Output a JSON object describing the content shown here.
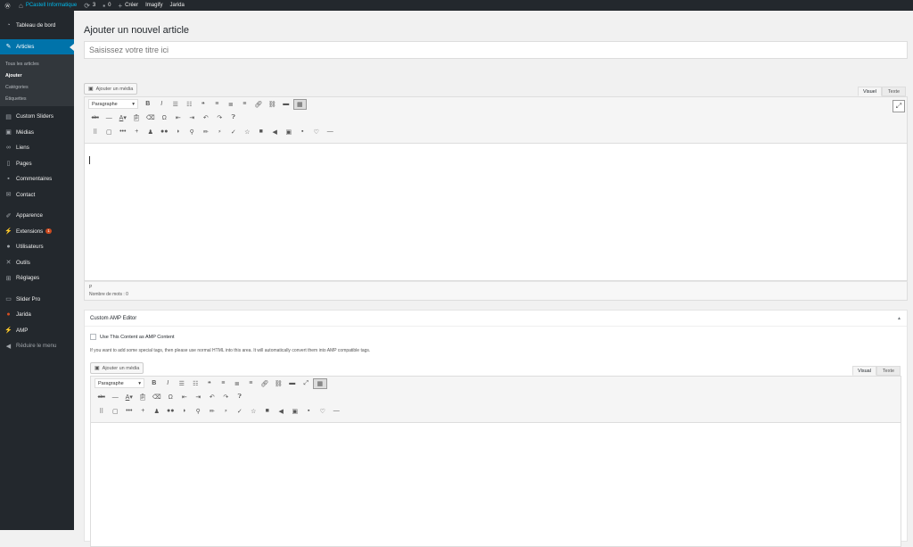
{
  "admin_bar": {
    "site_name": "PCastell Informatique",
    "updates_count": "3",
    "comments_count": "0",
    "new_label": "Créer",
    "imagify_label": "Imagify",
    "jarida_label": "Jarida"
  },
  "sidebar": {
    "dashboard": "Tableau de bord",
    "articles": "Articles",
    "submenu": [
      "Tous les articles",
      "Ajouter",
      "Catégories",
      "Étiquettes"
    ],
    "custom_sliders": "Custom Sliders",
    "medias": "Médias",
    "liens": "Liens",
    "pages": "Pages",
    "commentaires": "Commentaires",
    "contact": "Contact",
    "apparence": "Apparence",
    "extensions": "Extensions",
    "extensions_badge": "1",
    "utilisateurs": "Utilisateurs",
    "outils": "Outils",
    "reglages": "Réglages",
    "slider_pro": "Slider Pro",
    "jarida": "Jarida",
    "amp": "AMP",
    "collapse": "Réduire le menu"
  },
  "page": {
    "title": "Ajouter un nouvel article",
    "title_placeholder": "Saisissez votre titre ici"
  },
  "editor": {
    "add_media": "Ajouter un média",
    "tab_visual": "Visuel",
    "tab_text": "Texte",
    "format_select": "Paragraphe",
    "path": "P",
    "word_count": "Nombre de mots : 0"
  },
  "amp_box": {
    "title": "Custom AMP Editor",
    "checkbox_label": "Use This Content as AMP Content",
    "help_text": "If you want to add some special tags, then please use normal HTML into this area. It will automatically convert them into AMP compatible tags.",
    "add_media": "Ajouter un média",
    "tab_visual": "Visual",
    "tab_text": "Texte",
    "format_select": "Paragraphe"
  },
  "colors": {
    "accent": "#0073aa",
    "sidebar": "#23282d",
    "badge": "#ca4a1f"
  }
}
